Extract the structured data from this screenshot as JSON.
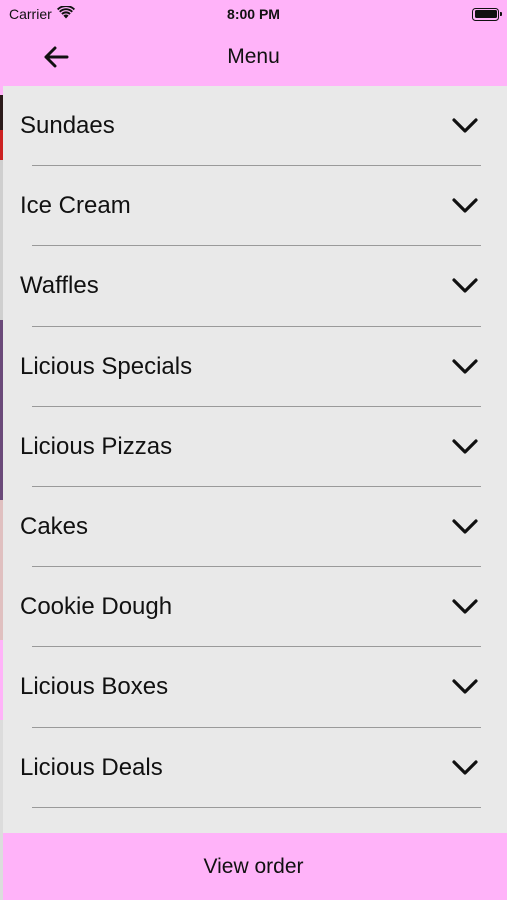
{
  "status_bar": {
    "carrier": "Carrier",
    "time": "8:00 PM",
    "wifi_icon": "wifi-icon",
    "battery_level": 1.0
  },
  "nav": {
    "title": "Menu",
    "back_icon": "arrow-left-icon"
  },
  "menu": {
    "items": [
      {
        "label": "Sundaes"
      },
      {
        "label": "Ice Cream"
      },
      {
        "label": "Waffles"
      },
      {
        "label": "Licious Specials"
      },
      {
        "label": "Licious Pizzas"
      },
      {
        "label": "Cakes"
      },
      {
        "label": "Cookie Dough"
      },
      {
        "label": "Licious Boxes"
      },
      {
        "label": "Licious Deals"
      }
    ],
    "expand_icon": "chevron-down-icon"
  },
  "footer": {
    "label": "View order"
  },
  "colors": {
    "accent": "#ffb3f9",
    "background": "#e9e9e9",
    "divider": "#9a9a9a",
    "text": "#111111"
  }
}
